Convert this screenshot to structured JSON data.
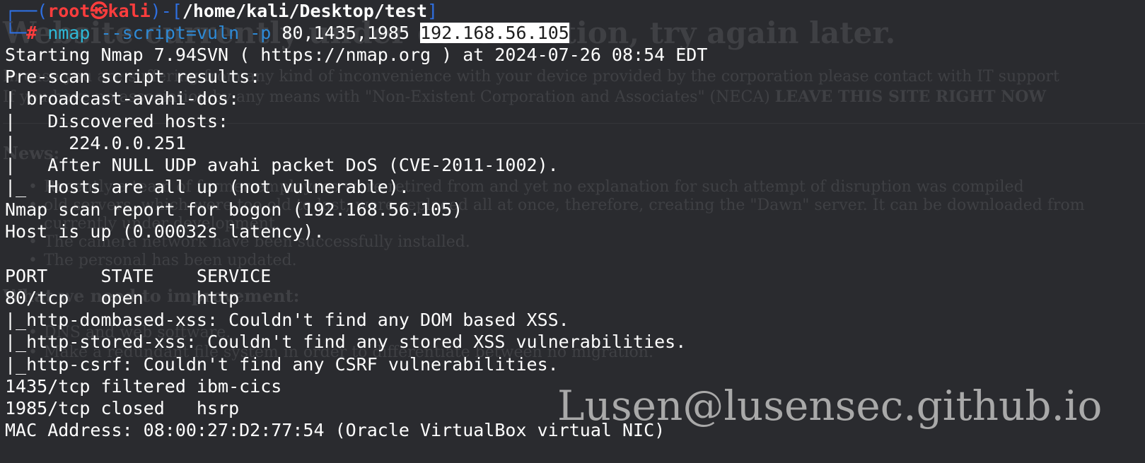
{
  "background_page": {
    "heading": "Website currently under construction, try again later.",
    "paragraph_1": "In case you are suffering from any kind of inconvenience with your device provided by the corporation please contact with IT support",
    "paragraph_2_prefix": "If you have no association by any means with \"Non-Existent Corporation and Associates\" (NECA) ",
    "paragraph_2_bold": "LEAVE THIS SITE RIGHT NOW",
    "news_heading": "News:",
    "news_items": [
      "Recently a team of former employees were retired from and yet no explanation for such attempt of disruption was compiled",
      "old servers, which were too old to last, were replaced all at once, therefore, creating the \"Dawn\" server. It can be downloaded from",
      "currently under development.",
      "The camera network have been successfully installed.",
      "The personal has been updated."
    ],
    "improve_heading": "What we need to improvement:",
    "improve_items": [
      "DNS and web software.",
      "Make a redundant file system in order to differentiate between no migration."
    ]
  },
  "prompt": {
    "corner_top": "┌──(",
    "user": "root",
    "at_symbol": "㉿",
    "host": "kali",
    "mid": ")-[",
    "path": "/home/kali/Desktop/test",
    "close": "]",
    "corner_bottom": "└─",
    "hash": "#",
    "command": "nmap",
    "options": "--script=vuln -p",
    "ports": "80,1435,1985",
    "target": "192.168.56.105"
  },
  "output_lines": [
    "Starting Nmap 7.94SVN ( https://nmap.org ) at 2024-07-26 08:54 EDT",
    "Pre-scan script results:",
    "| broadcast-avahi-dos:",
    "|   Discovered hosts:",
    "|     224.0.0.251",
    "|   After NULL UDP avahi packet DoS (CVE-2011-1002).",
    "|_  Hosts are all up (not vulnerable).",
    "Nmap scan report for bogon (192.168.56.105)",
    "Host is up (0.00032s latency).",
    "",
    "PORT     STATE    SERVICE",
    "80/tcp   open     http",
    "|_http-dombased-xss: Couldn't find any DOM based XSS.",
    "|_http-stored-xss: Couldn't find any stored XSS vulnerabilities.",
    "|_http-csrf: Couldn't find any CSRF vulnerabilities.",
    "1435/tcp filtered ibm-cics",
    "1985/tcp closed   hsrp",
    "MAC Address: 08:00:27:D2:77:54 (Oracle VirtualBox virtual NIC)"
  ],
  "watermark": "Lusen@lusensec.github.io",
  "colors": {
    "background": "#2a2b2f",
    "prompt_frame": "#2f6fe0",
    "prompt_user": "#ff3d3d",
    "command": "#2eb8d6",
    "text": "#ffffff",
    "watermark": "#a9a9a9"
  }
}
